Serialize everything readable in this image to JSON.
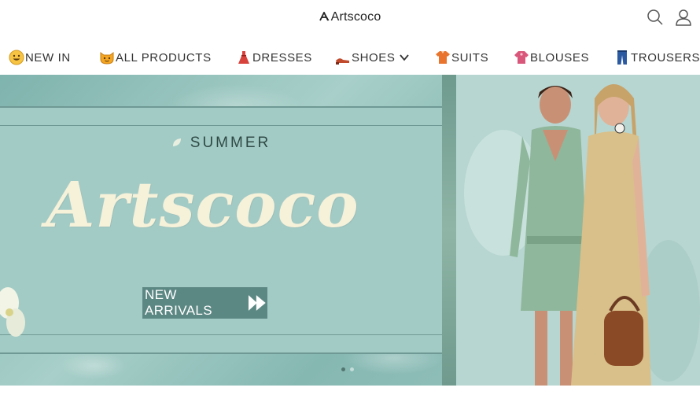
{
  "header": {
    "logo_text": "Artscoco",
    "search_icon": "search-icon",
    "account_icon": "user-icon"
  },
  "nav": {
    "items": [
      {
        "label": "NEW IN",
        "icon": "grinning-face-emoji"
      },
      {
        "label": "ALL PRODUCTS",
        "icon": "smiling-cat-emoji"
      },
      {
        "label": "DRESSES",
        "icon": "dress-emoji"
      },
      {
        "label": "SHOES",
        "icon": "high-heel-emoji",
        "has_dropdown": true
      },
      {
        "label": "SUITS",
        "icon": "shirt-emoji"
      },
      {
        "label": "BLOUSES",
        "icon": "blouse-emoji"
      },
      {
        "label": "TROUSERS",
        "icon": "jeans-emoji"
      }
    ]
  },
  "hero": {
    "eyebrow": "SUMMER",
    "brand": "Artscoco",
    "cta_label": "NEW ARRIVALS",
    "slides_total": 2,
    "active_slide": 1,
    "colors": {
      "panel": "#a3cbc6",
      "cta_bg": "#5c8884",
      "brand_text": "#f6f1d9"
    }
  }
}
